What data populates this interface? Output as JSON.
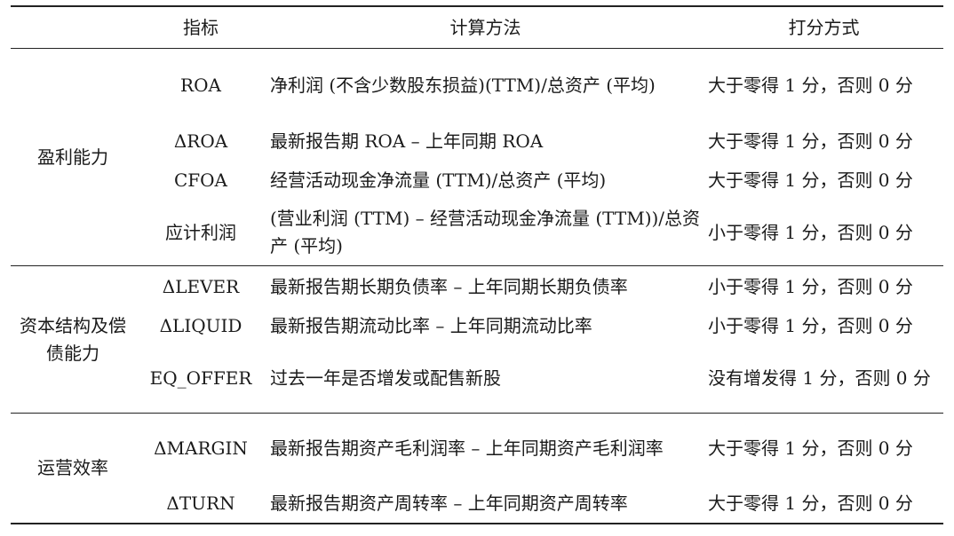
{
  "table": {
    "headers": {
      "indicator": "指标",
      "calc": "计算方法",
      "score": "打分方式"
    },
    "groups": [
      {
        "category": "盈利能力",
        "rows": [
          {
            "indicator": "ROA",
            "calc": "净利润 (不含少数股东损益)(TTM)/总资产 (平均)",
            "score": "大于零得 1 分，否则 0 分"
          },
          {
            "indicator": "ΔROA",
            "calc": "最新报告期 ROA – 上年同期 ROA",
            "score": "大于零得 1 分，否则 0 分"
          },
          {
            "indicator": "CFOA",
            "calc": "经营活动现金净流量 (TTM)/总资产 (平均)",
            "score": "大于零得 1 分，否则 0 分"
          },
          {
            "indicator": "应计利润",
            "calc": "(营业利润 (TTM) – 经营活动现金净流量 (TTM))/总资产 (平均)",
            "score": "小于零得 1 分，否则 0 分"
          }
        ]
      },
      {
        "category": "资本结构及偿债能力",
        "rows": [
          {
            "indicator": "ΔLEVER",
            "calc": "最新报告期长期负债率 – 上年同期长期负债率",
            "score": "小于零得 1 分，否则 0 分"
          },
          {
            "indicator": "ΔLIQUID",
            "calc": "最新报告期流动比率 – 上年同期流动比率",
            "score": "小于零得 1 分，否则 0 分"
          },
          {
            "indicator": "EQ_OFFER",
            "calc": "过去一年是否增发或配售新股",
            "score": "没有增发得 1 分，否则 0 分"
          }
        ]
      },
      {
        "category": "运营效率",
        "rows": [
          {
            "indicator": "ΔMARGIN",
            "calc": "最新报告期资产毛利润率 – 上年同期资产毛利润率",
            "score": "大于零得 1 分，否则 0 分"
          },
          {
            "indicator": "ΔTURN",
            "calc": "最新报告期资产周转率 – 上年同期资产周转率",
            "score": "大于零得 1 分，否则 0 分"
          }
        ]
      }
    ]
  }
}
